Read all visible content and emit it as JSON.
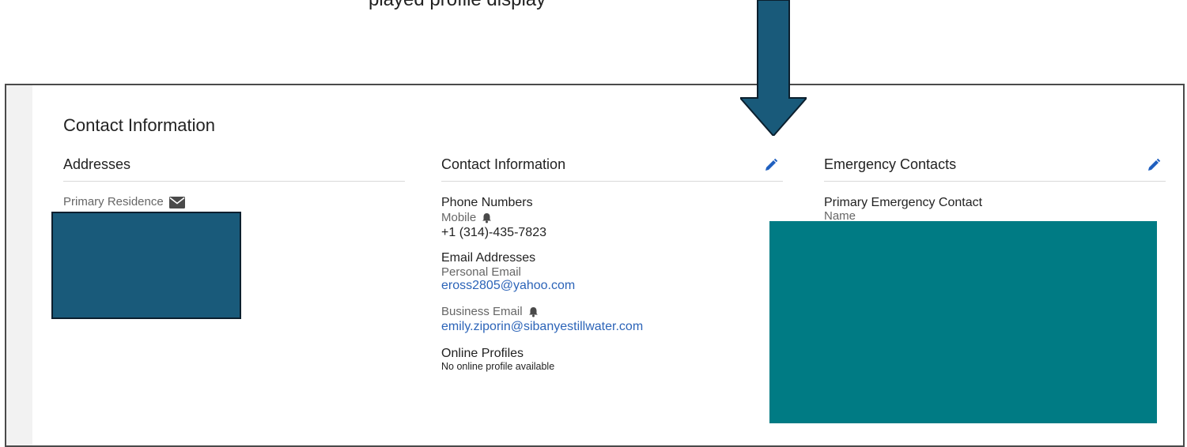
{
  "caption": "played profile display",
  "page": {
    "title": "Contact Information"
  },
  "addresses": {
    "title": "Addresses",
    "primary_residence_label": "Primary Residence",
    "mail_icon": "envelope-icon"
  },
  "contact": {
    "title": "Contact Information",
    "edit_icon": "pencil-icon",
    "phone": {
      "group_title": "Phone Numbers",
      "type": "Mobile",
      "notify_icon": "bell-icon",
      "value": "+1 (314)-435-7823"
    },
    "email": {
      "group_title": "Email Addresses",
      "personal_label": "Personal Email",
      "personal_value": "eross2805@yahoo.com",
      "business_label": "Business Email",
      "business_notify_icon": "bell-icon",
      "business_value": "emily.ziporin@sibanyestillwater.com"
    },
    "online": {
      "group_title": "Online Profiles",
      "empty_text": "No online profile available"
    }
  },
  "emergency": {
    "title": "Emergency Contacts",
    "edit_icon": "pencil-icon",
    "primary_label": "Primary Emergency Contact",
    "name_label": "Name"
  },
  "colors": {
    "link": "#2c64b8",
    "edit_icon": "#1f5fbf",
    "arrow": "#195a7a",
    "redaction_address": "#195a7a",
    "redaction_emergency": "#007b84"
  }
}
